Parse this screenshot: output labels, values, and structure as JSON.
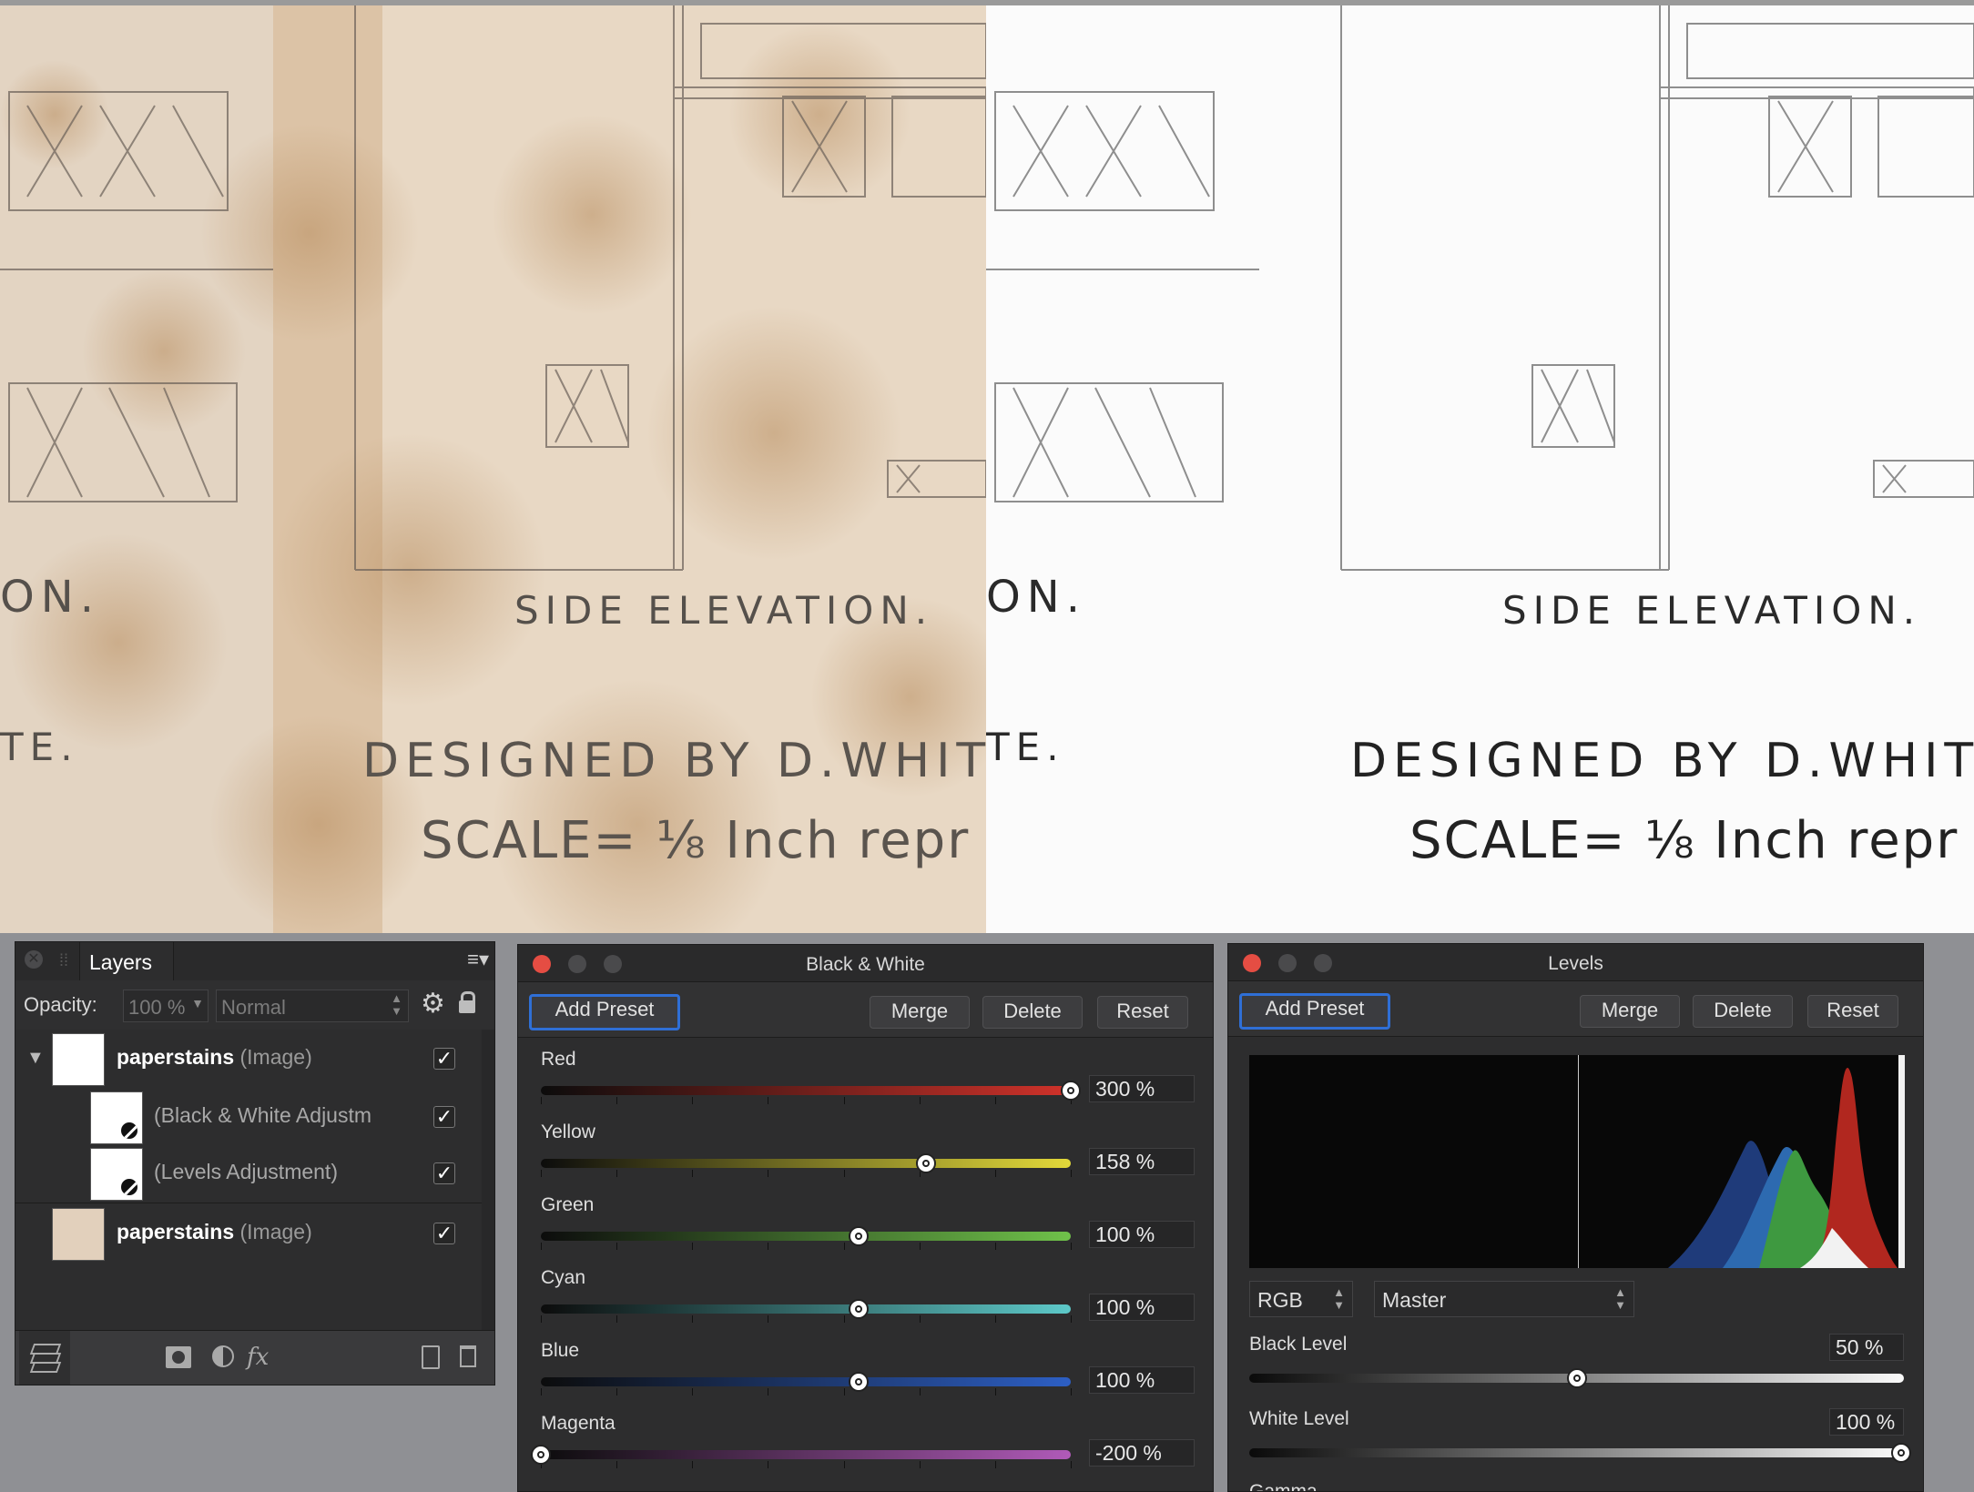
{
  "document": {
    "drawing": {
      "side_elevation": "SIDE ELEVATION.",
      "partial_on": "ON.",
      "partial_te": "TE.",
      "designed_by": "DESIGNED BY D.WHITE",
      "scale": "SCALE= ⅛ Inch repr"
    }
  },
  "layers_panel": {
    "tab_label": "Layers",
    "opacity_label": "Opacity:",
    "opacity_value": "100 %",
    "blend_mode": "Normal",
    "layers": [
      {
        "name": "paperstains",
        "type": "(Image)",
        "visible": "✓"
      },
      {
        "name": "(Black & White Adjustm",
        "visible": "✓"
      },
      {
        "name": "(Levels Adjustment)",
        "visible": "✓"
      },
      {
        "name": "paperstains",
        "type": "(Image)",
        "visible": "✓"
      }
    ],
    "footer_icons": [
      "layers-stack-icon",
      "mask-icon",
      "adjustment-icon",
      "fx-icon",
      "new-layer-icon",
      "trash-icon"
    ],
    "fx_label": "fx"
  },
  "bw_panel": {
    "title": "Black & White",
    "buttons": {
      "add_preset": "Add Preset",
      "merge": "Merge",
      "delete": "Delete",
      "reset": "Reset"
    },
    "sliders": [
      {
        "label": "Red",
        "value": "300 %",
        "position": 1.0,
        "color": "#d0322a"
      },
      {
        "label": "Yellow",
        "value": "158 %",
        "position": 0.726,
        "color": "#e3d93a"
      },
      {
        "label": "Green",
        "value": "100 %",
        "position": 0.6,
        "color": "#6fc14a"
      },
      {
        "label": "Cyan",
        "value": "100 %",
        "position": 0.6,
        "color": "#5dc9c9"
      },
      {
        "label": "Blue",
        "value": "100 %",
        "position": 0.6,
        "color": "#2d5fc4"
      },
      {
        "label": "Magenta",
        "value": "-200 %",
        "position": 0.0,
        "color": "#b05ab8"
      }
    ]
  },
  "levels_panel": {
    "title": "Levels",
    "buttons": {
      "add_preset": "Add Preset",
      "merge": "Merge",
      "delete": "Delete",
      "reset": "Reset"
    },
    "channel_mode": "RGB",
    "channel": "Master",
    "black_level": {
      "label": "Black Level",
      "value": "50 %",
      "position": 0.5
    },
    "white_level": {
      "label": "White Level",
      "value": "100 %",
      "position": 1.0
    },
    "cut_label": "Gamma"
  }
}
